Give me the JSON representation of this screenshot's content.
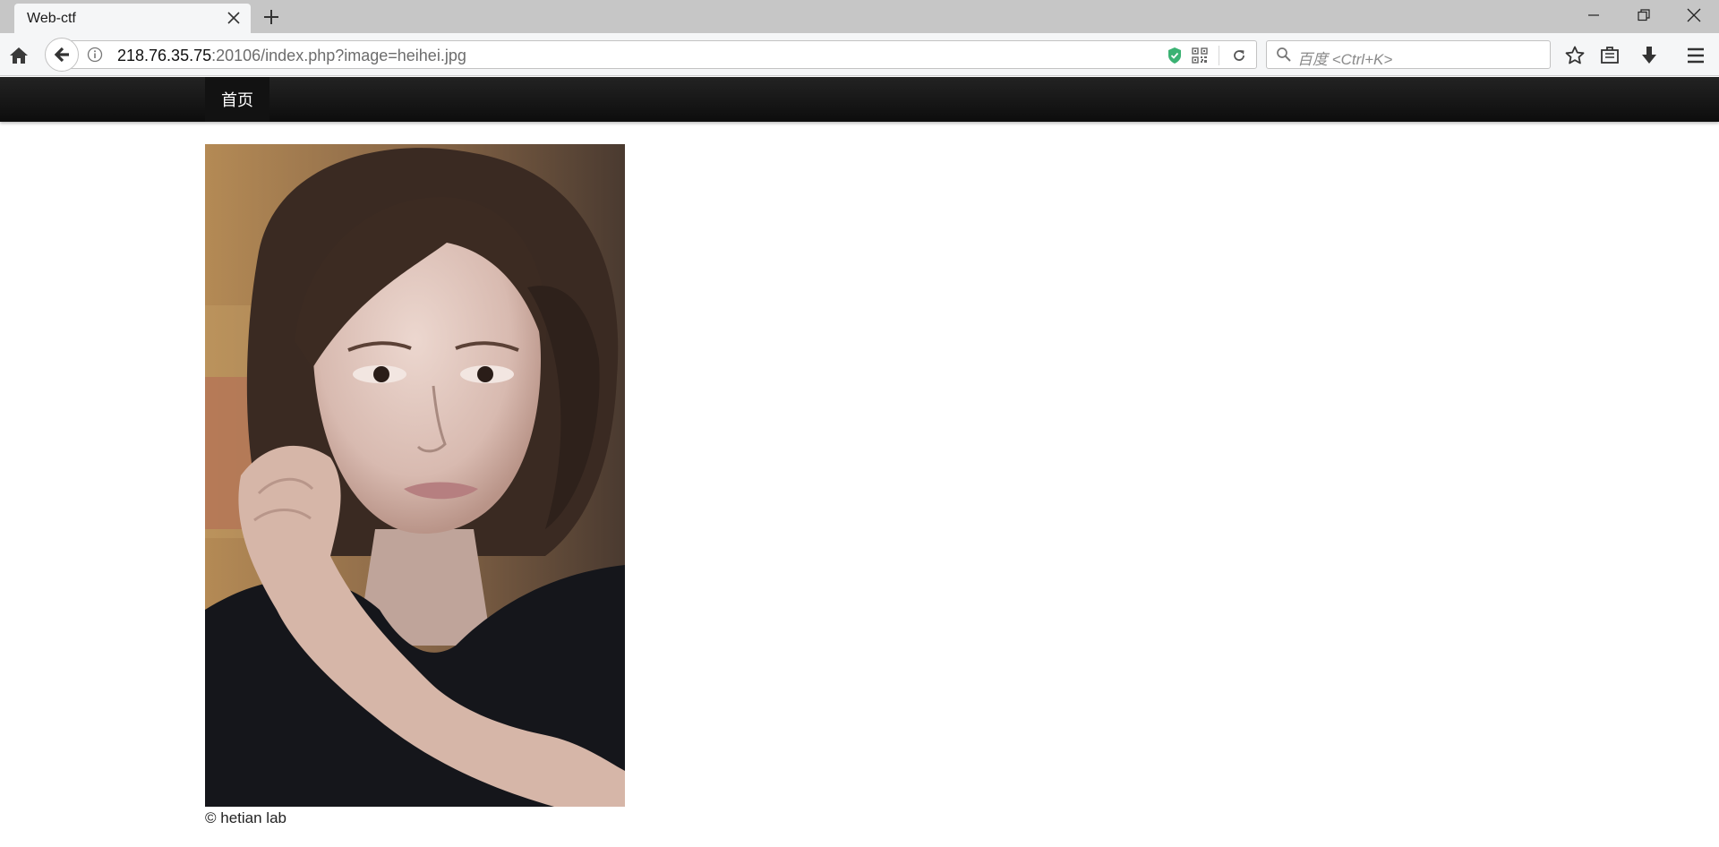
{
  "browser": {
    "tab": {
      "title": "Web-ctf"
    },
    "url": {
      "host": "218.76.35.75",
      "rest": ":20106/index.php?image=heihei.jpg"
    },
    "search": {
      "placeholder": "百度 <Ctrl+K>"
    },
    "icons": [
      "home-icon",
      "back-arrow-icon",
      "info-icon",
      "shield-icon",
      "qr-code-icon",
      "reload-icon",
      "search-icon",
      "star-icon",
      "library-icon",
      "download-icon",
      "hamburger-menu-icon",
      "close-icon",
      "plus-icon",
      "minimize-icon",
      "restore-icon"
    ]
  },
  "page": {
    "nav": {
      "home_label": "首页"
    },
    "image": {
      "description": "portrait photo"
    },
    "footer": "© hetian lab"
  },
  "colors": {
    "navbar": "#1a1a1a",
    "tabbar": "#c6c6c6",
    "toolbar": "#f5f6f7",
    "shield": "#3bb273"
  }
}
